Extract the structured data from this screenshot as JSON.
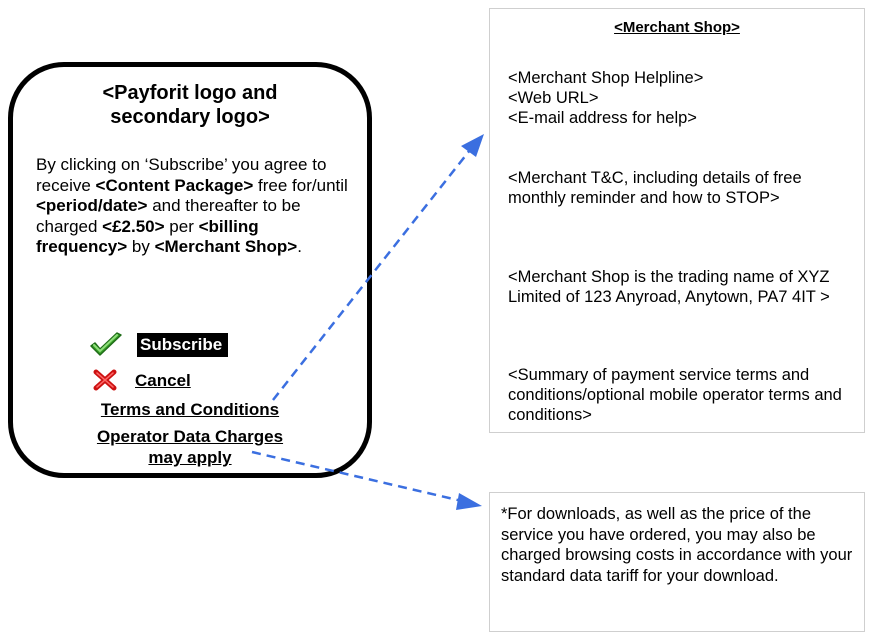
{
  "phone": {
    "logo_line1": "<Payforit logo and",
    "logo_line2": "secondary logo>",
    "body": {
      "t1": "By clicking on ‘Subscribe’ you agree to receive ",
      "b1": "<Content Package>",
      "t2": " free for/until ",
      "b2": "<period/date>",
      "t3": " and thereafter to be charged ",
      "b3": "<£2.50>",
      "t4": " per ",
      "b4": "<billing frequency>",
      "t5": " by ",
      "b5": "<Merchant Shop>",
      "t6": "."
    },
    "subscribe_label": "Subscribe",
    "cancel_label": "Cancel",
    "terms_label": "Terms and Conditions",
    "operator_line1": "Operator Data Charges",
    "operator_line2": "may apply"
  },
  "merchant": {
    "title": "<Merchant Shop>",
    "helpline": "<Merchant Shop Helpline>",
    "web_url": "<Web URL>",
    "email": "<E-mail address for help>",
    "tandc": "<Merchant T&C, including details of free monthly reminder and how to STOP>",
    "trading": "<Merchant Shop is the trading name of XYZ Limited of 123 Anyroad, Anytown, PA7 4IT >",
    "summary": "<Summary of payment service terms and conditions/optional mobile operator terms and conditions>"
  },
  "footnote": {
    "text": "*For downloads, as well as the price of the service you have ordered, you may also be charged browsing costs in accordance with your standard data tariff for your download."
  },
  "icons": {
    "subscribe": "check-icon",
    "cancel": "cross-icon"
  },
  "colors": {
    "arrow": "#3b6fe0",
    "check_green": "#3aa02a",
    "cross_red": "#cc1111"
  }
}
